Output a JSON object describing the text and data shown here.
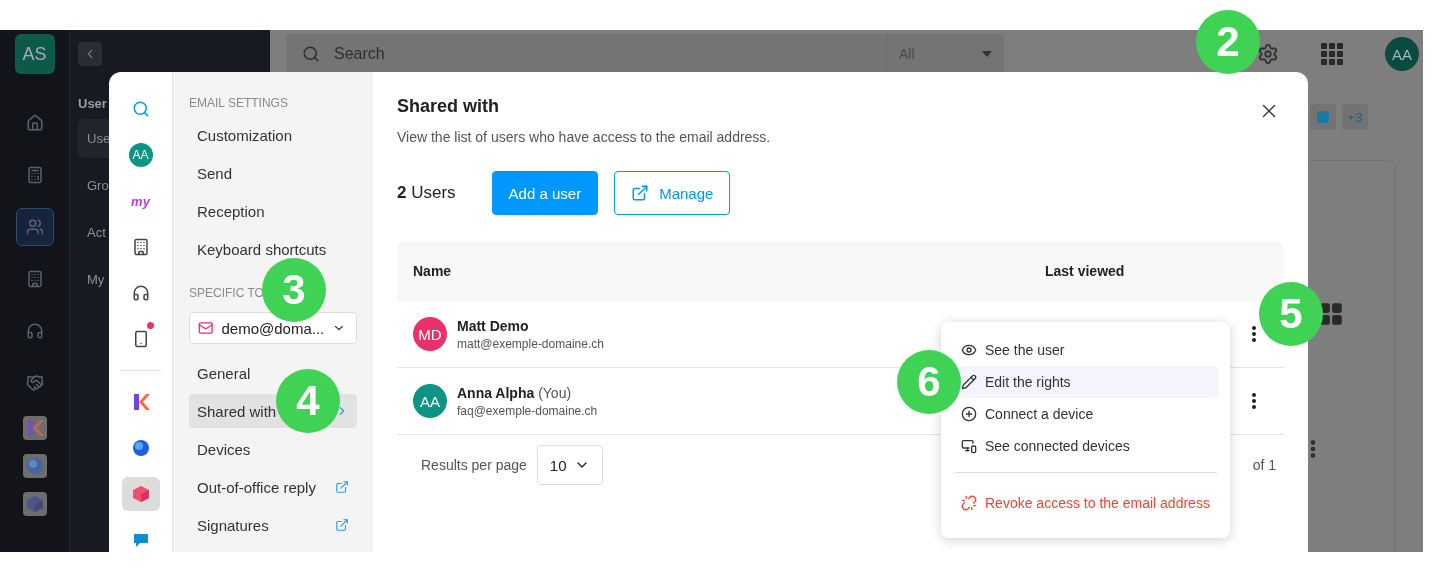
{
  "app": {
    "account_badge": "AS",
    "sidebar_title": "User",
    "sidebar_items": [
      {
        "label": "Use",
        "selected": true
      },
      {
        "label": "Gro",
        "selected": false
      },
      {
        "label": "Act",
        "selected": false
      },
      {
        "label": "My",
        "selected": false
      }
    ],
    "rail": [
      {
        "kind": "home",
        "selected": false
      },
      {
        "kind": "calculator",
        "selected": false
      },
      {
        "kind": "users",
        "selected": true
      },
      {
        "kind": "building",
        "selected": false
      },
      {
        "kind": "headset",
        "selected": false
      },
      {
        "kind": "handshake",
        "selected": false
      },
      {
        "kind": "k-app",
        "selected": false
      },
      {
        "kind": "orb-app",
        "selected": false
      },
      {
        "kind": "cube-app",
        "selected": false
      }
    ],
    "search": {
      "placeholder": "Search",
      "scope": "All"
    },
    "avatar": "AA",
    "more_badge": "+3"
  },
  "modal": {
    "apps": [
      {
        "kind": "search",
        "selected": false
      },
      {
        "kind": "avatar",
        "label": "AA",
        "selected": false
      },
      {
        "kind": "my-logo",
        "label": "my",
        "selected": false
      },
      {
        "kind": "building",
        "selected": false
      },
      {
        "kind": "headset",
        "selected": false
      },
      {
        "kind": "device-sync",
        "notification": true,
        "selected": false
      },
      {
        "kind": "divider"
      },
      {
        "kind": "k-app",
        "selected": false
      },
      {
        "kind": "orb-app",
        "selected": false
      },
      {
        "kind": "cube-app",
        "selected": true
      },
      {
        "kind": "chat-app",
        "selected": false
      }
    ],
    "nav_sections": [
      {
        "heading": "EMAIL SETTINGS",
        "items": [
          {
            "label": "Customization",
            "selected": false,
            "external": false
          },
          {
            "label": "Send",
            "selected": false,
            "external": false
          },
          {
            "label": "Reception",
            "selected": false,
            "external": false
          },
          {
            "label": "Keyboard shortcuts",
            "selected": false,
            "external": false
          }
        ]
      },
      {
        "heading": "SPECIFIC TO",
        "mailbox": "demo@doma...",
        "items": [
          {
            "label": "General",
            "selected": false,
            "external": false
          },
          {
            "label": "Shared with",
            "selected": true,
            "external": false
          },
          {
            "label": "Devices",
            "selected": false,
            "external": false
          },
          {
            "label": "Out-of-office reply",
            "selected": false,
            "external": true
          },
          {
            "label": "Signatures",
            "selected": false,
            "external": true
          }
        ]
      }
    ],
    "title": "Shared with",
    "description": "View the list of users who have access to the email address.",
    "count": "**2** Users",
    "buttons": [
      {
        "label": "Add a user",
        "kind": "primary"
      },
      {
        "label": "Manage",
        "kind": "outline"
      }
    ],
    "table": {
      "columns": [
        "Name",
        "Last viewed"
      ],
      "rows": [
        {
          "initials": "MD",
          "color": "#e8306a",
          "name": "Matt Demo",
          "note": "",
          "email": "matt@exemple-domaine.ch"
        },
        {
          "initials": "AA",
          "color": "#0e9384",
          "name": "Anna Alpha",
          "note": "(You)",
          "email": "faq@exemple-domaine.ch"
        }
      ]
    },
    "pagination": {
      "label": "Results per page",
      "per_page": "10",
      "pages": "of 1"
    },
    "menu": [
      {
        "kind": "eye",
        "label": "See the user",
        "selected": false,
        "danger": false
      },
      {
        "kind": "pencil",
        "label": "Edit the rights",
        "selected": true,
        "danger": false
      },
      {
        "kind": "plus",
        "label": "Connect a device",
        "selected": false,
        "danger": false
      },
      {
        "kind": "monitor",
        "label": "See connected devices",
        "selected": false,
        "danger": false
      },
      {
        "kind": "unlink",
        "label": "Revoke access to the email address",
        "selected": false,
        "danger": true
      }
    ]
  },
  "callouts": [
    "2",
    "3",
    "4",
    "5",
    "6"
  ]
}
